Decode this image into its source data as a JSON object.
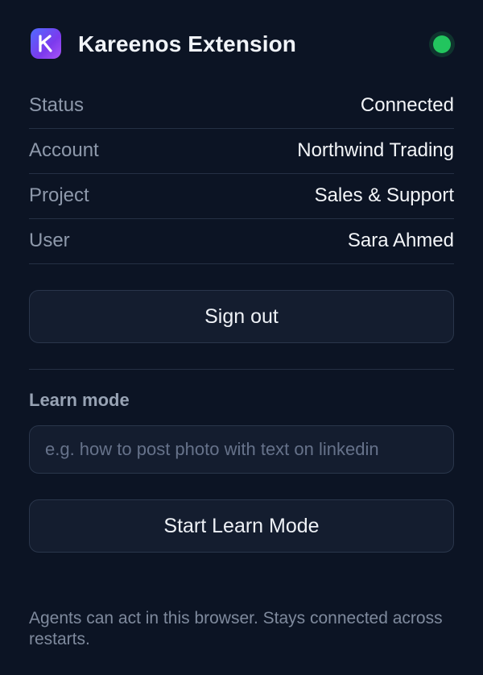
{
  "header": {
    "title": "Kareenos Extension",
    "logo_letter": "K",
    "status_indicator_color": "#22c55e"
  },
  "info": [
    {
      "key": "Status",
      "value": "Connected"
    },
    {
      "key": "Account",
      "value": "Northwind Trading"
    },
    {
      "key": "Project",
      "value": "Sales & Support"
    },
    {
      "key": "User",
      "value": "Sara Ahmed"
    }
  ],
  "actions": {
    "sign_out_label": "Sign out"
  },
  "learn_mode": {
    "label": "Learn mode",
    "input_value": "",
    "input_placeholder": "e.g. how to post photo with text on linkedin",
    "start_label": "Start Learn Mode"
  },
  "footer": {
    "note": "Agents can act in this browser. Stays connected across restarts."
  },
  "colors": {
    "background": "#0c1424",
    "accent_gradient_start": "#4f6bff",
    "accent_gradient_end": "#a855f7"
  }
}
